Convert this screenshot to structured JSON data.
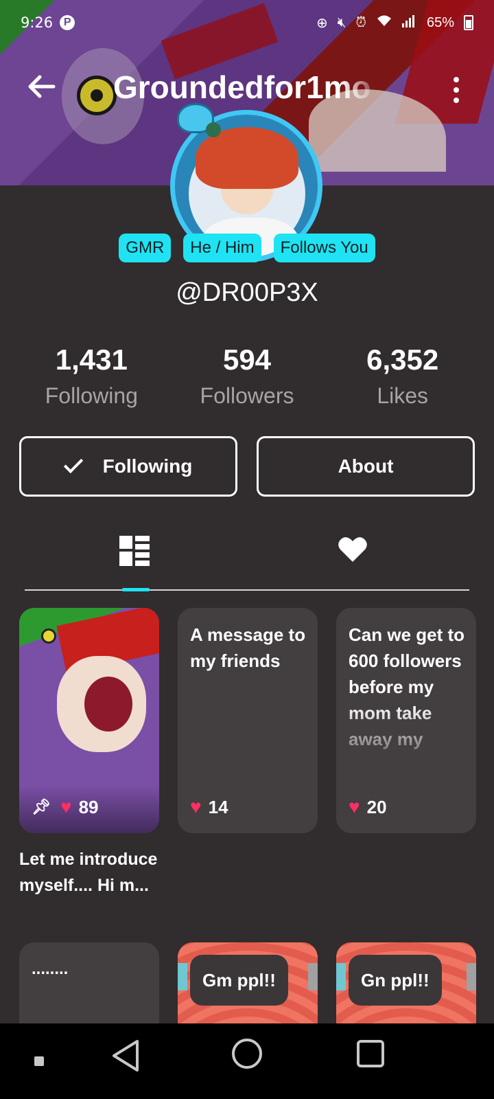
{
  "status_bar": {
    "time": "9:26",
    "pinterest_glyph": "P",
    "battery_percent": "65%",
    "icons": [
      "pinterest-icon",
      "data-saver-icon",
      "mute-icon",
      "alarm-icon",
      "wifi-icon",
      "signal-icon",
      "battery-icon"
    ]
  },
  "header": {
    "title": "Groundedfor1mo",
    "back_icon": "arrow-left-icon",
    "more_icon": "more-vertical-icon"
  },
  "profile": {
    "badges": [
      "GMR",
      "He / Him",
      "Follows You"
    ],
    "handle": "@DR00P3X",
    "stats": [
      {
        "value": "1,431",
        "label": "Following"
      },
      {
        "value": "594",
        "label": "Followers"
      },
      {
        "value": "6,352",
        "label": "Likes"
      }
    ],
    "following_button": "Following",
    "about_button": "About"
  },
  "tabs": {
    "active": "posts",
    "items": [
      {
        "name": "posts",
        "icon": "grid-icon"
      },
      {
        "name": "likes",
        "icon": "heart-icon"
      }
    ]
  },
  "posts": [
    {
      "type": "image",
      "likes": "89",
      "pinned": true,
      "caption": "Let me introduce myself.... Hi m..."
    },
    {
      "type": "text",
      "text": "A message to my friends",
      "likes": "14"
    },
    {
      "type": "text",
      "text": "Can we get to 600 followers before my mom take away my",
      "likes": "20"
    },
    {
      "type": "text",
      "text": "........"
    },
    {
      "type": "text-on-image",
      "text": "Gm ppl!!"
    },
    {
      "type": "text-on-image",
      "text": "Gn ppl!!"
    }
  ],
  "colors": {
    "accent": "#1fe3f2",
    "background": "#312c2e",
    "card": "#433e40",
    "like": "#ff2e63",
    "ring": "#3fc8f4"
  }
}
